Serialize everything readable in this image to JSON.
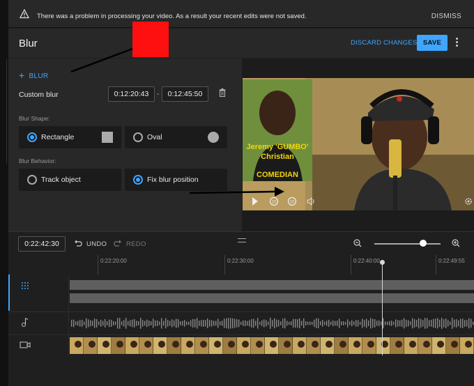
{
  "warning": {
    "message": "There was a problem in processing your video. As a result your recent edits were not saved.",
    "dismiss_label": "DISMISS"
  },
  "header": {
    "title": "Blur",
    "discard_label": "DISCARD CHANGES",
    "save_label": "SAVE"
  },
  "panel": {
    "add_blur_label": "BLUR",
    "custom_blur_label": "Custom blur",
    "start_time": "0:12:20:43",
    "end_time": "0:12:45:50",
    "shape_section": "Blur Shape:",
    "shape_options": [
      {
        "label": "Rectangle",
        "selected": true
      },
      {
        "label": "Oval",
        "selected": false
      }
    ],
    "behavior_section": "Blur Behavior:",
    "behavior_options": [
      {
        "label": "Track object",
        "selected": false
      },
      {
        "label": "Fix blur position",
        "selected": true
      }
    ]
  },
  "video": {
    "overlay_line1": "Jeremy  'GUMBO'",
    "overlay_line2": "Christian",
    "overlay_line3": "COMEDIAN",
    "skip_back_label": "10",
    "skip_fwd_label": "10"
  },
  "timeline": {
    "current_time": "0:22:42:30",
    "undo_label": "UNDO",
    "redo_label": "REDO",
    "zoom_level": 0.7,
    "ticks": [
      "0:22:20:00",
      "0:22:30:00",
      "0:22:40:00",
      "0:22:49:55"
    ]
  },
  "colors": {
    "accent": "#3ea6ff",
    "red_box": "#ff1010",
    "panel_bg": "#282828"
  }
}
